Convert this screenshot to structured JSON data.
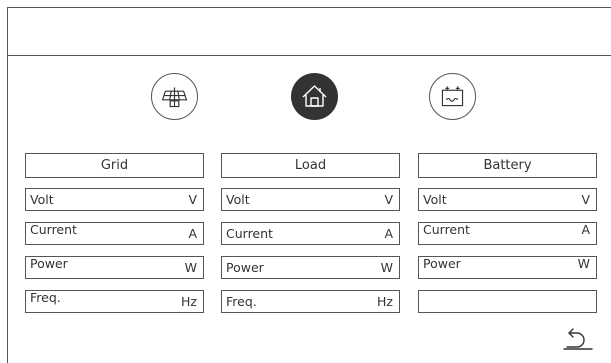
{
  "icons": [
    "solar-panel-icon",
    "home-icon",
    "battery-icon"
  ],
  "columns": [
    {
      "title": "Grid",
      "rows": [
        {
          "label": "Volt",
          "unit": "V"
        },
        {
          "label": "Current",
          "unit": "A"
        },
        {
          "label": "Power",
          "unit": "W"
        },
        {
          "label": "Freq.",
          "unit": "Hz"
        }
      ]
    },
    {
      "title": "Load",
      "rows": [
        {
          "label": "Volt",
          "unit": "V"
        },
        {
          "label": "Current",
          "unit": "A"
        },
        {
          "label": "Power",
          "unit": "W"
        },
        {
          "label": "Freq.",
          "unit": "Hz"
        }
      ]
    },
    {
      "title": "Battery",
      "rows": [
        {
          "label": "Volt",
          "unit": "V"
        },
        {
          "label": "Current",
          "unit": "A"
        },
        {
          "label": "Power",
          "unit": "W"
        },
        {
          "label": "",
          "unit": ""
        }
      ]
    }
  ],
  "actions": {
    "back_icon": "back-arrow-icon"
  },
  "colors": {
    "line": "#555555",
    "text": "#333333",
    "icon_fill": "#333333"
  }
}
